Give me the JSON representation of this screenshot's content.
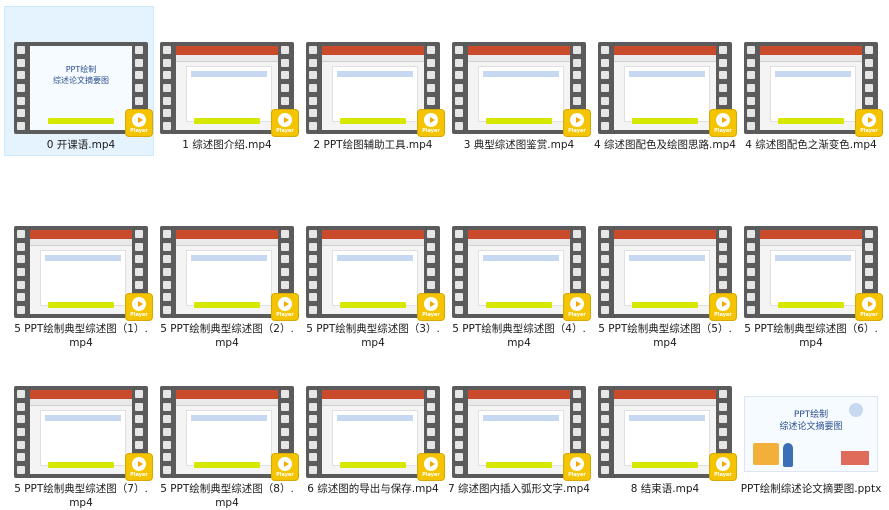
{
  "files": [
    {
      "name": "0 开课语.mp4",
      "kind": "video",
      "selected": true,
      "title": "PPT绘制\n综述论文摘要图"
    },
    {
      "name": "1 综述图介绍.mp4",
      "kind": "video"
    },
    {
      "name": "2 PPT绘图辅助工具.mp4",
      "kind": "video"
    },
    {
      "name": "3 典型综述图鉴赏.mp4",
      "kind": "video"
    },
    {
      "name": "4 综述图配色及绘图思路.mp4",
      "kind": "video"
    },
    {
      "name": "4 综述图配色之渐变色.mp4",
      "kind": "video"
    },
    {
      "name": "5 PPT绘制典型综述图（1）.mp4",
      "kind": "video"
    },
    {
      "name": "5 PPT绘制典型综述图（2）.mp4",
      "kind": "video"
    },
    {
      "name": "5 PPT绘制典型综述图（3）.mp4",
      "kind": "video"
    },
    {
      "name": "5 PPT绘制典型综述图（4）.mp4",
      "kind": "video"
    },
    {
      "name": "5 PPT绘制典型综述图（5）.mp4",
      "kind": "video"
    },
    {
      "name": "5 PPT绘制典型综述图（6）.mp4",
      "kind": "video"
    },
    {
      "name": "5 PPT绘制典型综述图（7）.mp4",
      "kind": "video"
    },
    {
      "name": "5 PPT绘制典型综述图（8）.mp4",
      "kind": "video"
    },
    {
      "name": "6 综述图的导出与保存.mp4",
      "kind": "video"
    },
    {
      "name": "7 综述图内插入弧形文字.mp4",
      "kind": "video"
    },
    {
      "name": "8 结束语.mp4",
      "kind": "video"
    },
    {
      "name": "PPT绘制综述论文摘要图.pptx",
      "kind": "pptx",
      "title": "PPT绘制\n综述论文摘要图"
    }
  ],
  "player_badge": "Player"
}
